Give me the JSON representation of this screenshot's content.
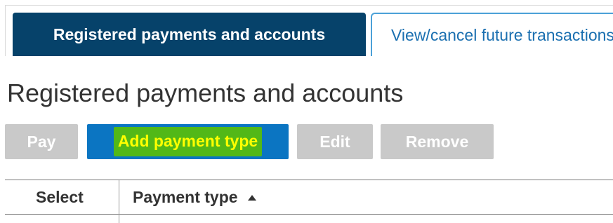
{
  "tabs": [
    {
      "label": "Registered payments and accounts",
      "active": true
    },
    {
      "label": "View/cancel future transactions",
      "active": false
    }
  ],
  "page_title": "Registered payments and accounts",
  "buttons": {
    "pay": "Pay",
    "add_payment_type": "Add payment type",
    "edit": "Edit",
    "remove": "Remove"
  },
  "table": {
    "columns": [
      "Select",
      "Payment type"
    ],
    "sort_column": "Payment type",
    "sort_direction": "ascending"
  },
  "colors": {
    "active_tab": "#06426a",
    "inactive_tab_border": "#4ba1d8",
    "primary_button": "#0b75c2",
    "disabled_button": "#c9c9c9",
    "highlight_background": "#52b818",
    "highlight_text": "#ffff00"
  }
}
